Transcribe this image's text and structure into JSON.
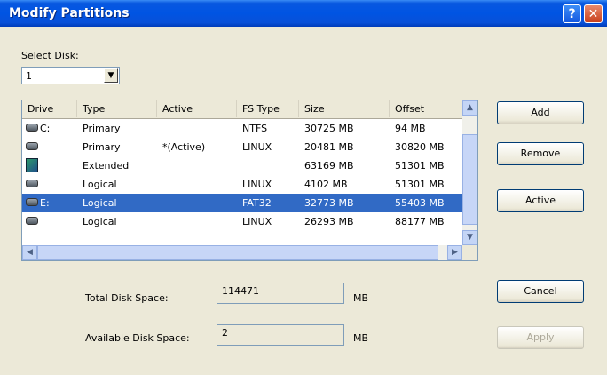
{
  "window": {
    "title": "Modify Partitions",
    "help_glyph": "?",
    "close_glyph": "✕"
  },
  "disk": {
    "label": "Select Disk:",
    "value": "1"
  },
  "table": {
    "columns": [
      "Drive",
      "Type",
      "Active",
      "FS Type",
      "Size",
      "Offset"
    ],
    "rows": [
      {
        "drive": "C:",
        "icon": "hard-drive-icon",
        "type": "Primary",
        "active": "",
        "fs": "NTFS",
        "size": "30725 MB",
        "offset": "94 MB"
      },
      {
        "drive": "",
        "icon": "hard-drive-icon",
        "type": "Primary",
        "active": "*(Active)",
        "fs": "LINUX",
        "size": "20481 MB",
        "offset": "30820 MB"
      },
      {
        "drive": "",
        "icon": "extended-partition-icon",
        "type": "Extended",
        "active": "",
        "fs": "",
        "size": "63169 MB",
        "offset": "51301 MB"
      },
      {
        "drive": "",
        "icon": "hard-drive-icon",
        "type": "Logical",
        "active": "",
        "fs": "LINUX",
        "size": "4102 MB",
        "offset": "51301 MB"
      },
      {
        "drive": "E:",
        "icon": "hard-drive-icon",
        "type": "Logical",
        "active": "",
        "fs": "FAT32",
        "size": "32773 MB",
        "offset": "55403 MB",
        "selected": true
      },
      {
        "drive": "",
        "icon": "hard-drive-icon",
        "type": "Logical",
        "active": "",
        "fs": "LINUX",
        "size": "26293 MB",
        "offset": "88177 MB"
      }
    ]
  },
  "buttons": {
    "add": "Add",
    "remove": "Remove",
    "active": "Active",
    "cancel": "Cancel",
    "apply": "Apply"
  },
  "space": {
    "total_label": "Total Disk Space:",
    "total_value": "114471",
    "total_unit": "MB",
    "avail_label": "Available Disk Space:",
    "avail_value": "2",
    "avail_unit": "MB"
  },
  "colors": {
    "titlebar": "#0054e3",
    "selection": "#316ac5",
    "dialog_bg": "#ece9d8"
  }
}
